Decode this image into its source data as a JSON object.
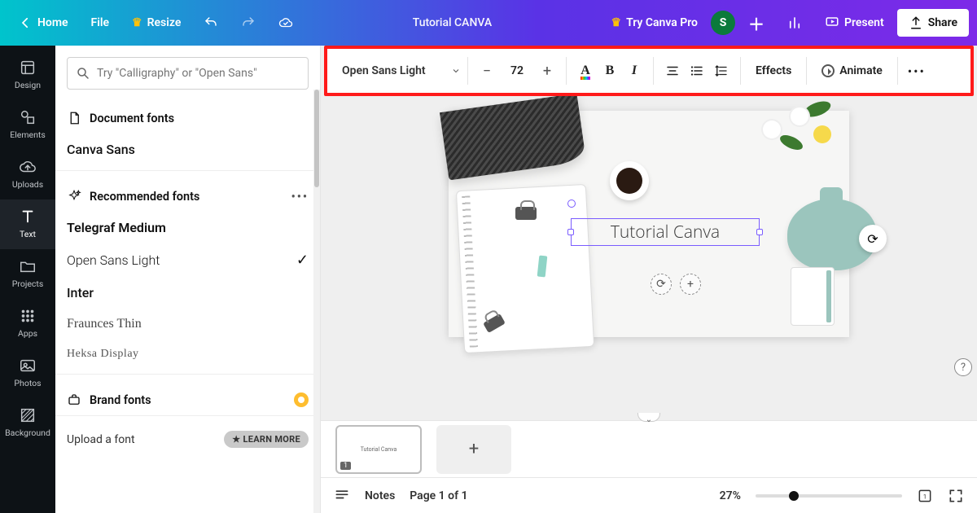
{
  "header": {
    "home": "Home",
    "file": "File",
    "resize": "Resize",
    "doc_title": "Tutorial CANVA",
    "pro": "Try Canva Pro",
    "avatar_letter": "S",
    "present": "Present",
    "share": "Share"
  },
  "rail": {
    "items": [
      {
        "label": "Design"
      },
      {
        "label": "Elements"
      },
      {
        "label": "Uploads"
      },
      {
        "label": "Text"
      },
      {
        "label": "Projects"
      },
      {
        "label": "Apps"
      },
      {
        "label": "Photos"
      },
      {
        "label": "Background"
      }
    ]
  },
  "panel": {
    "search_placeholder": "Try \"Calligraphy\" or \"Open Sans\"",
    "doc_fonts_head": "Document fonts",
    "doc_font": "Canva Sans",
    "rec_head": "Recommended fonts",
    "rec": [
      {
        "name": "Telegraf Medium",
        "selected": false
      },
      {
        "name": "Open Sans Light",
        "selected": true
      },
      {
        "name": "Inter",
        "selected": false
      },
      {
        "name": "Fraunces Thin",
        "selected": false
      },
      {
        "name": "Heksa Display",
        "selected": false
      }
    ],
    "brand_head": "Brand fonts",
    "upload": "Upload a font",
    "learn": "LEARN MORE"
  },
  "toolbar": {
    "font": "Open Sans Light",
    "size": "72",
    "effects": "Effects",
    "animate": "Animate"
  },
  "canvas": {
    "text": "Tutorial Canva",
    "thumb_text": "Tutorial Canva",
    "page_num": "1"
  },
  "footer": {
    "notes": "Notes",
    "page_label": "Page 1 of 1",
    "zoom": "27%"
  }
}
